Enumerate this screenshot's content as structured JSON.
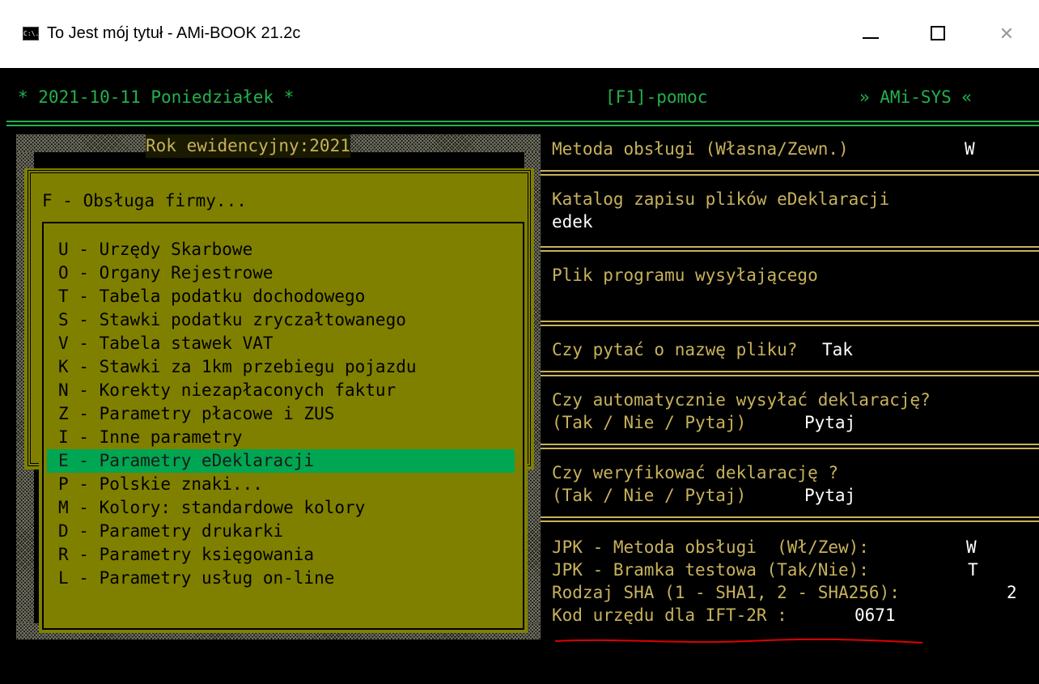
{
  "window": {
    "title": "To Jest mój tytuł - AMi-BOOK 21.2c",
    "app_icon_label": "C:\\.",
    "controls": {
      "minimize": "—",
      "maximize": "□",
      "close": "✕"
    }
  },
  "header": {
    "date": "* 2021-10-11 Poniedziałek *",
    "help": "[F1]-pomoc",
    "brand": "» AMi-SYS «"
  },
  "left": {
    "year_label": "Rok ewidencyjny:2021",
    "submenu_title": "F - Obsługa firmy...",
    "items": [
      "U - Urzędy Skarbowe",
      "O - Organy Rejestrowe",
      "T - Tabela podatku dochodowego",
      "S - Stawki podatku zryczałtowanego",
      "V - Tabela stawek VAT",
      "K - Stawki za 1km przebiegu pojazdu",
      "N - Korekty niezapłaconych faktur",
      "Z - Parametry płacowe i ZUS",
      "I - Inne parametry",
      "E - Parametry eDeklaracji",
      "P - Polskie znaki...",
      "M - Kolory: standardowe kolory",
      "D - Parametry drukarki",
      "R - Parametry księgowania",
      "L - Parametry usług on-line"
    ],
    "selected_index": 9
  },
  "right": {
    "method_label": "Metoda obsługi (Własna/Zewn.)",
    "method_value": "W",
    "catalog_label": "Katalog zapisu plików eDeklaracji",
    "catalog_value": "edek",
    "sender_label": "Plik programu wysyłającego",
    "ask_filename_label": "Czy pytać o nazwę pliku?",
    "ask_filename_value": "Tak",
    "auto_send_label": "Czy automatycznie wysyłać deklarację?",
    "auto_send_options": "(Tak / Nie / Pytaj)",
    "auto_send_value": "Pytaj",
    "verify_label": "Czy weryfikować deklarację ?",
    "verify_options": "(Tak / Nie / Pytaj)",
    "verify_value": "Pytaj",
    "jpk_method_label": "JPK - Metoda obsługi  (Wł/Zew):",
    "jpk_method_value": "W",
    "jpk_gate_label": "JPK - Bramka testowa (Tak/Nie):",
    "jpk_gate_value": "T",
    "sha_label": "Rodzaj SHA (1 - SHA1, 2 - SHA256):",
    "sha_value": "2",
    "office_code_label": "Kod urzędu dla IFT-2R :",
    "office_code_value": "0671"
  },
  "colors": {
    "header_green": "#22b14c",
    "panel_olive": "#808000",
    "selection_green": "#00a651",
    "frame_yellow": "#c7b25b",
    "annotation_red": "#e00000"
  }
}
